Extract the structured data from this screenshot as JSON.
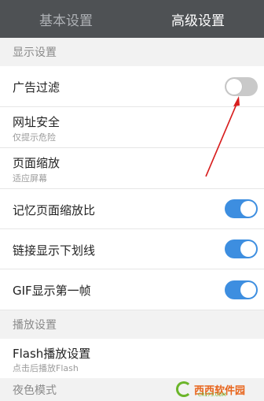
{
  "tabs": [
    {
      "label": "基本设置",
      "active": false
    },
    {
      "label": "高级设置",
      "active": true
    }
  ],
  "sections": {
    "display": {
      "header": "显示设置"
    },
    "playback": {
      "header": "播放设置"
    },
    "night": {
      "header": "夜色模式"
    }
  },
  "rows": {
    "ad_filter": {
      "title": "广告过滤",
      "toggle": "off"
    },
    "url_security": {
      "title": "网址安全",
      "subtitle": "仅提示危险"
    },
    "page_zoom": {
      "title": "页面缩放",
      "subtitle": "适应屏幕"
    },
    "remember_zoom": {
      "title": "记忆页面缩放比",
      "toggle": "on"
    },
    "link_underline": {
      "title": "链接显示下划线",
      "toggle": "on"
    },
    "gif_first_frame": {
      "title": "GIF显示第一帧",
      "toggle": "on"
    },
    "flash_settings": {
      "title": "Flash播放设置",
      "subtitle": "点击后播放Flash"
    }
  },
  "colors": {
    "tabbar_bg": "#4e5154",
    "toggle_on": "#3d8ee0",
    "toggle_off": "#c9c9c9",
    "annotation_arrow": "#d81e1e"
  },
  "watermark": {
    "text": "西西软件园",
    "small": "CR173.COM"
  }
}
